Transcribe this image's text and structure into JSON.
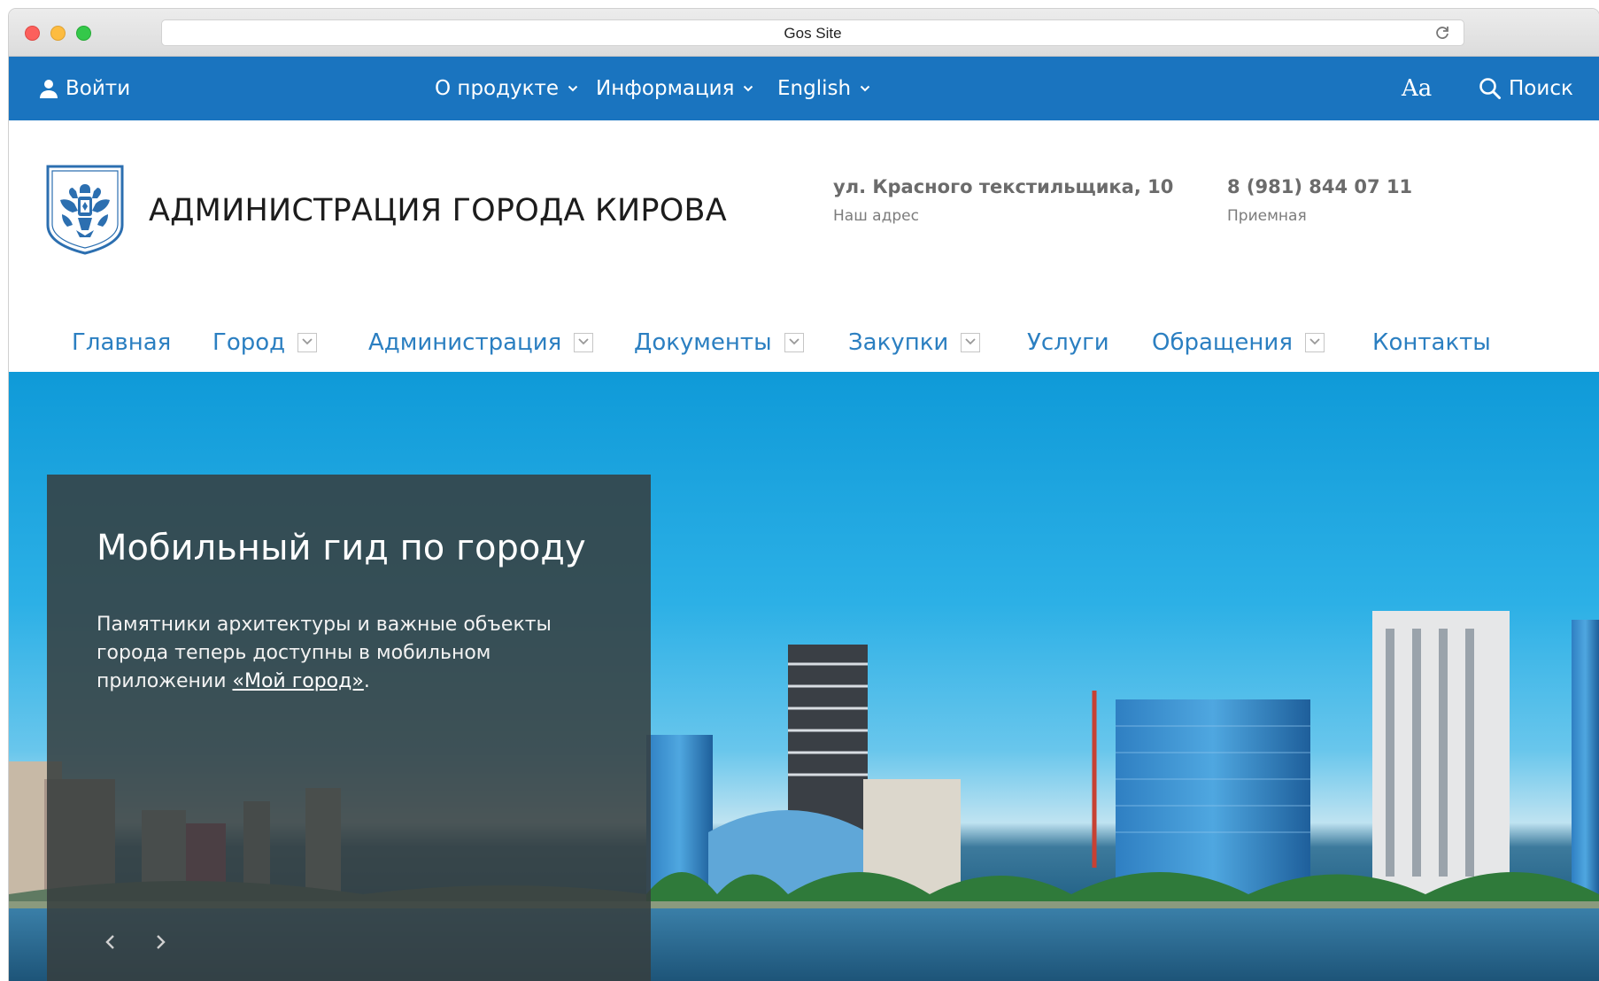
{
  "browser": {
    "tab_title": "Gos Site"
  },
  "topbar": {
    "login_label": "Войти",
    "menu": [
      {
        "label": "О продукте"
      },
      {
        "label": "Информация"
      },
      {
        "label": "English"
      }
    ],
    "font_size_label": "Aa",
    "search_label": "Поиск"
  },
  "header": {
    "title": "АДМИНИСТРАЦИЯ ГОРОДА КИРОВА",
    "address_value": "ул. Красного текстильщика, 10",
    "address_label": "Наш адрес",
    "phone_value": "8 (981) 844 07 11",
    "phone_label": "Приемная"
  },
  "nav": {
    "items": [
      {
        "label": "Главная",
        "has_dropdown": false
      },
      {
        "label": "Город",
        "has_dropdown": true
      },
      {
        "label": "Администрация",
        "has_dropdown": true
      },
      {
        "label": "Документы",
        "has_dropdown": true
      },
      {
        "label": "Закупки",
        "has_dropdown": true
      },
      {
        "label": "Услуги",
        "has_dropdown": false
      },
      {
        "label": "Обращения",
        "has_dropdown": true
      },
      {
        "label": "Контакты",
        "has_dropdown": false
      }
    ]
  },
  "hero": {
    "title": "Мобильный гид по городу",
    "body_before": "Памятники архитектуры и важные объекты города теперь доступны в мобильном приложении ",
    "link_text": "«Мой город»",
    "body_after": "."
  },
  "colors": {
    "topbar": "#1a74bf",
    "nav_link": "#2b7fc1",
    "card_overlay": "#373e3e"
  }
}
